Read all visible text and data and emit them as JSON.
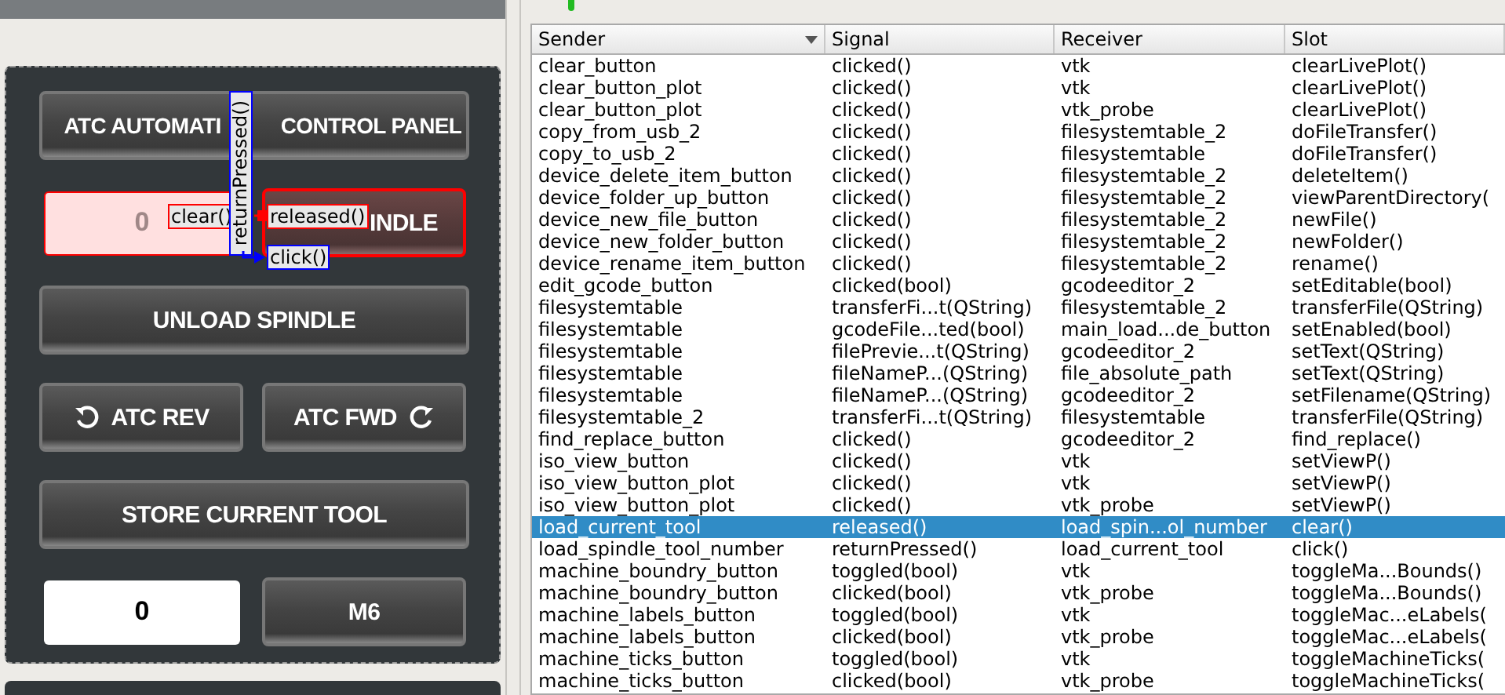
{
  "atc_panel": {
    "title_button": [
      "ATC AUTOMATI",
      "CONTROL PANEL"
    ],
    "tool_number_field": {
      "value": "0",
      "highlighted": true
    },
    "load_button": {
      "label": "INDLE",
      "highlighted": true
    },
    "unload_button": "UNLOAD SPINDLE",
    "rev_button": "ATC REV",
    "fwd_button": "ATC FWD",
    "store_button": "STORE CURRENT TOOL",
    "tool_field": {
      "value": "0"
    },
    "m6_button": "M6"
  },
  "connections": [
    {
      "signal": "released()",
      "slot": "clear()",
      "color": "#ff0000"
    },
    {
      "signal": "returnPressed()",
      "slot": "click()",
      "color": "#0000ff"
    }
  ],
  "table": {
    "columns": [
      {
        "label": "Sender",
        "sorted": true
      },
      {
        "label": "Signal",
        "sorted": false
      },
      {
        "label": "Receiver",
        "sorted": false
      },
      {
        "label": "Slot",
        "sorted": false
      }
    ],
    "rows": [
      {
        "cells": [
          "clear_button",
          "clicked()",
          "vtk",
          "clearLivePlot()"
        ],
        "selected": false
      },
      {
        "cells": [
          "clear_button_plot",
          "clicked()",
          "vtk",
          "clearLivePlot()"
        ],
        "selected": false
      },
      {
        "cells": [
          "clear_button_plot",
          "clicked()",
          "vtk_probe",
          "clearLivePlot()"
        ],
        "selected": false
      },
      {
        "cells": [
          "copy_from_usb_2",
          "clicked()",
          "filesystemtable_2",
          "doFileTransfer()"
        ],
        "selected": false
      },
      {
        "cells": [
          "copy_to_usb_2",
          "clicked()",
          "filesystemtable",
          "doFileTransfer()"
        ],
        "selected": false
      },
      {
        "cells": [
          "device_delete_item_button",
          "clicked()",
          "filesystemtable_2",
          "deleteItem()"
        ],
        "selected": false
      },
      {
        "cells": [
          "device_folder_up_button",
          "clicked()",
          "filesystemtable_2",
          "viewParentDirectory("
        ],
        "selected": false
      },
      {
        "cells": [
          "device_new_file_button",
          "clicked()",
          "filesystemtable_2",
          "newFile()"
        ],
        "selected": false
      },
      {
        "cells": [
          "device_new_folder_button",
          "clicked()",
          "filesystemtable_2",
          "newFolder()"
        ],
        "selected": false
      },
      {
        "cells": [
          "device_rename_item_button",
          "clicked()",
          "filesystemtable_2",
          "rename()"
        ],
        "selected": false
      },
      {
        "cells": [
          "edit_gcode_button",
          "clicked(bool)",
          "gcodeeditor_2",
          "setEditable(bool)"
        ],
        "selected": false
      },
      {
        "cells": [
          "filesystemtable",
          "transferFi...t(QString)",
          "filesystemtable_2",
          "transferFile(QString)"
        ],
        "selected": false
      },
      {
        "cells": [
          "filesystemtable",
          "gcodeFile...ted(bool)",
          "main_load...de_button",
          "setEnabled(bool)"
        ],
        "selected": false
      },
      {
        "cells": [
          "filesystemtable",
          "filePrevie...t(QString)",
          "gcodeeditor_2",
          "setText(QString)"
        ],
        "selected": false
      },
      {
        "cells": [
          "filesystemtable",
          "fileNameP...(QString)",
          "file_absolute_path",
          "setText(QString)"
        ],
        "selected": false
      },
      {
        "cells": [
          "filesystemtable",
          "fileNameP...(QString)",
          "gcodeeditor_2",
          "setFilename(QString)"
        ],
        "selected": false
      },
      {
        "cells": [
          "filesystemtable_2",
          "transferFi...t(QString)",
          "filesystemtable",
          "transferFile(QString)"
        ],
        "selected": false
      },
      {
        "cells": [
          "find_replace_button",
          "clicked()",
          "gcodeeditor_2",
          "find_replace()"
        ],
        "selected": false
      },
      {
        "cells": [
          "iso_view_button",
          "clicked()",
          "vtk",
          "setViewP()"
        ],
        "selected": false
      },
      {
        "cells": [
          "iso_view_button_plot",
          "clicked()",
          "vtk",
          "setViewP()"
        ],
        "selected": false
      },
      {
        "cells": [
          "iso_view_button_plot",
          "clicked()",
          "vtk_probe",
          "setViewP()"
        ],
        "selected": false
      },
      {
        "cells": [
          "load_current_tool",
          "released()",
          "load_spin...ol_number",
          "clear()"
        ],
        "selected": true
      },
      {
        "cells": [
          "load_spindle_tool_number",
          "returnPressed()",
          "load_current_tool",
          "click()"
        ],
        "selected": false
      },
      {
        "cells": [
          "machine_boundry_button",
          "toggled(bool)",
          "vtk",
          "toggleMa...Bounds()"
        ],
        "selected": false
      },
      {
        "cells": [
          "machine_boundry_button",
          "clicked(bool)",
          "vtk_probe",
          "toggleMa...Bounds()"
        ],
        "selected": false
      },
      {
        "cells": [
          "machine_labels_button",
          "toggled(bool)",
          "vtk",
          "toggleMac...eLabels("
        ],
        "selected": false
      },
      {
        "cells": [
          "machine_labels_button",
          "clicked(bool)",
          "vtk_probe",
          "toggleMac...eLabels("
        ],
        "selected": false
      },
      {
        "cells": [
          "machine_ticks_button",
          "toggled(bool)",
          "vtk",
          "toggleMachineTicks("
        ],
        "selected": false
      },
      {
        "cells": [
          "machine_ticks_button",
          "clicked(bool)",
          "vtk_probe",
          "toggleMachineTicks("
        ],
        "selected": false
      }
    ]
  }
}
